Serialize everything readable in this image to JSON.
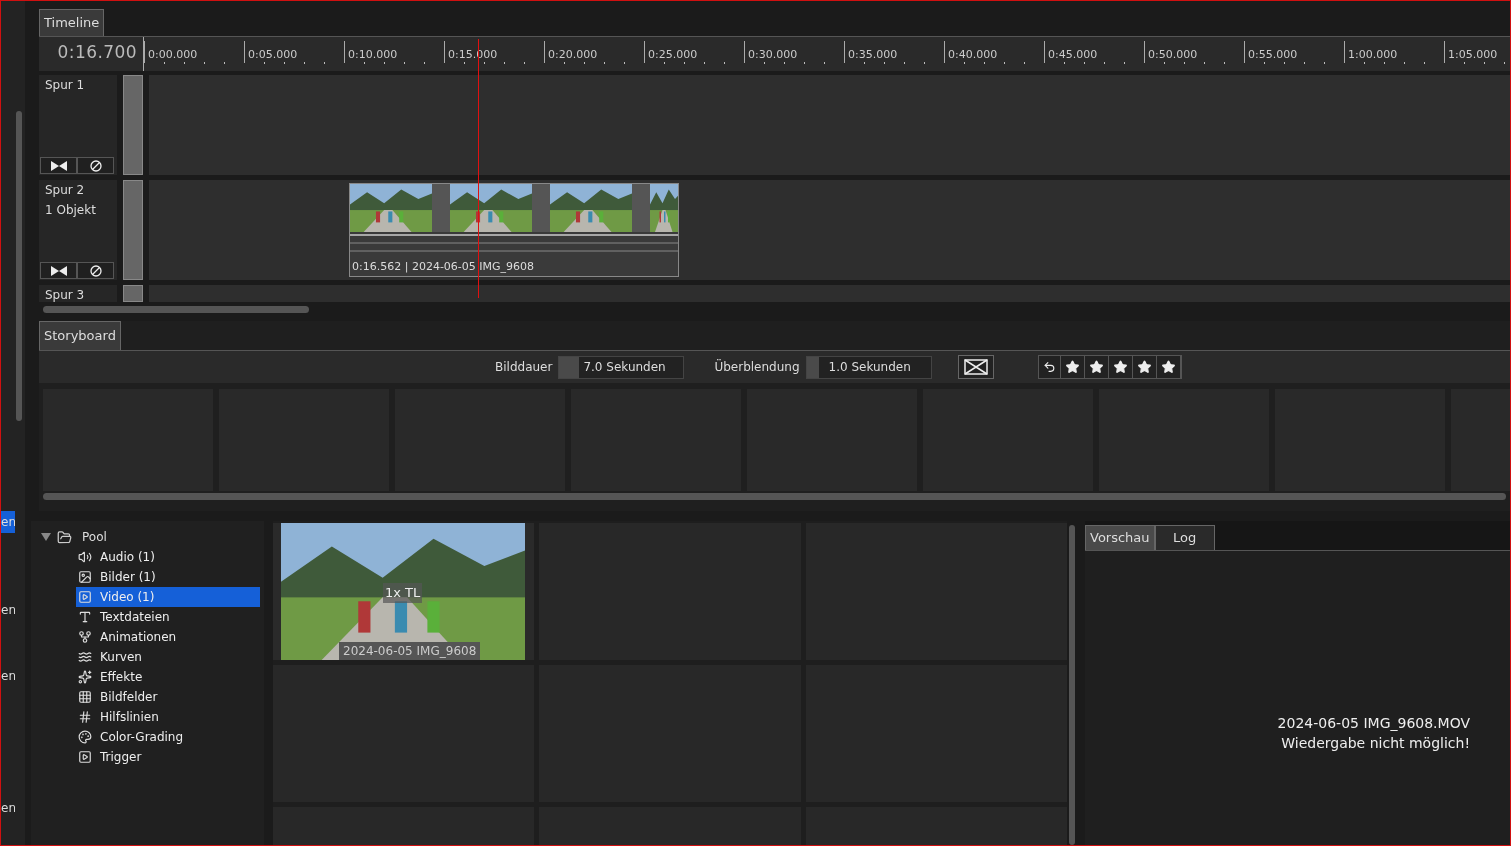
{
  "side_panel": {
    "items": [
      {
        "label": "en",
        "selected": true
      },
      {
        "label": "en",
        "selected": false
      },
      {
        "label": "en",
        "selected": false
      },
      {
        "label": "en",
        "selected": false
      }
    ]
  },
  "timeline": {
    "tab": "Timeline",
    "time": "0:16.700",
    "ruler": [
      "0:00.000",
      "0:05.000",
      "0:10.000",
      "0:15.000",
      "0:20.000",
      "0:25.000",
      "0:30.000",
      "0:35.000",
      "0:40.000",
      "0:45.000",
      "0:50.000",
      "0:55.000",
      "1:00.000",
      "1:05.000"
    ],
    "tracks": [
      {
        "name": "Spur 1"
      },
      {
        "name": "Spur 2",
        "info": "1 Objekt",
        "clips": [
          {
            "label": "0:16.562 | 2024-06-05 IMG_9608"
          }
        ]
      },
      {
        "name": "Spur 3"
      }
    ]
  },
  "storyboard": {
    "tab": "Storyboard",
    "duration_label": "Bilddauer",
    "duration_value": "7.0 Sekunden",
    "transition_label": "Überblendung",
    "transition_value": "1.0 Sekunden",
    "stars": 5
  },
  "pool": {
    "root": {
      "label": "Pool",
      "expanded": true,
      "children": [
        {
          "label": "Audio (1)",
          "selected": false
        },
        {
          "label": "Bilder (1)",
          "selected": false
        },
        {
          "label": "Video (1)",
          "selected": true
        },
        {
          "label": "Textdateien",
          "selected": false
        },
        {
          "label": "Animationen",
          "selected": false
        },
        {
          "label": "Kurven",
          "selected": false
        },
        {
          "label": "Effekte",
          "selected": false
        },
        {
          "label": "Bildfelder",
          "selected": false
        },
        {
          "label": "Hilfslinien",
          "selected": false
        },
        {
          "label": "Color-Grading",
          "selected": false
        },
        {
          "label": "Trigger",
          "selected": false
        }
      ]
    }
  },
  "media": [
    {
      "title": "2024-06-05 IMG_9608",
      "badge": "1x TL"
    }
  ],
  "preview": {
    "tabs": [
      {
        "label": "Vorschau",
        "selected": true
      },
      {
        "label": "Log",
        "selected": false
      }
    ],
    "message": [
      "2024-06-05 IMG_9608.MOV",
      "Wiedergabe nicht möglich!"
    ]
  }
}
